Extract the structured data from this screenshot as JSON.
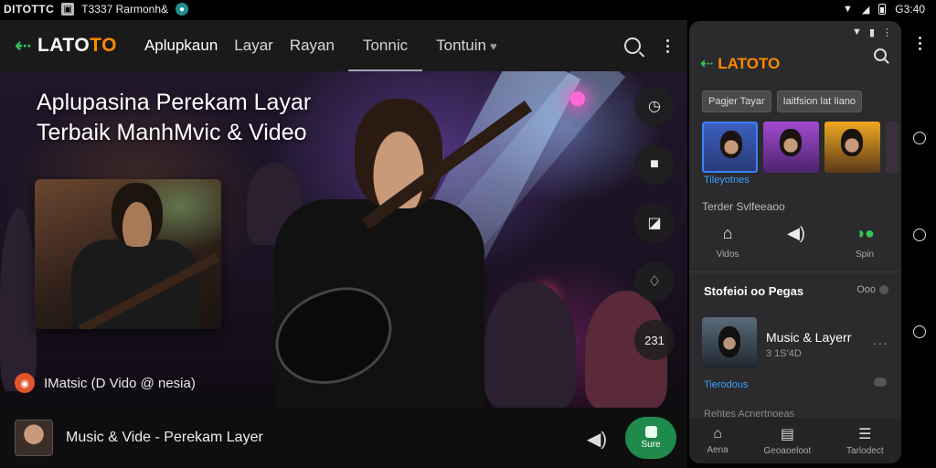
{
  "statusbar": {
    "app_name": "DITOTTC",
    "notification_text": "T3337 Rarmonh&",
    "time": "G3:40"
  },
  "header": {
    "logo_text_main": "LATO",
    "logo_text_accent": "TO",
    "tabs": [
      {
        "label": "Aplupkaun"
      },
      {
        "label": "Layar"
      },
      {
        "label": "Rayan"
      },
      {
        "label": "Tonnic"
      },
      {
        "label": "Tontuin"
      }
    ],
    "active_tab": "Tonnic"
  },
  "hero": {
    "title_line1": "Aplupasina Perekam Layar",
    "title_line2": "Terbaik ManhMvic & Video",
    "caption": "IMatsic (D Vido @ nesia)",
    "side_count": "231"
  },
  "player": {
    "title": "Music & Vide - Perekam Layer",
    "save_label": "Sure"
  },
  "panel": {
    "logo_text_main": "LATO",
    "logo_text_accent": "TO",
    "chips": [
      "Pagjer Tayar",
      "Iaitfsion lat Iiano"
    ],
    "thumb_label": "Tileyotnes",
    "section_label": "Terder Svlfeeaoo",
    "quick_actions": [
      {
        "label": "Vidos",
        "icon": "video-icon"
      },
      {
        "label": "",
        "icon": "volume-icon"
      },
      {
        "label": "Spin",
        "icon": "spin-toggle-icon"
      }
    ],
    "songs_title": "Stofeioi oo Pegas",
    "songs_more": "Ooo",
    "song": {
      "title": "Music & Layerr",
      "meta": "3 1S'4D",
      "tag": "Tierodous"
    },
    "faded_text": "Rehtes Acnertnoeas",
    "bottom_nav": [
      {
        "label": "Aena",
        "icon": "home-icon"
      },
      {
        "label": "Geoaoeloot",
        "icon": "library-icon"
      },
      {
        "label": "Tarlodect",
        "icon": "menu-icon"
      }
    ]
  },
  "colors": {
    "accent_orange": "#ff8a00",
    "accent_green": "#33c25a",
    "save_button": "#1f8a4c",
    "link_blue": "#3ea0ff"
  }
}
